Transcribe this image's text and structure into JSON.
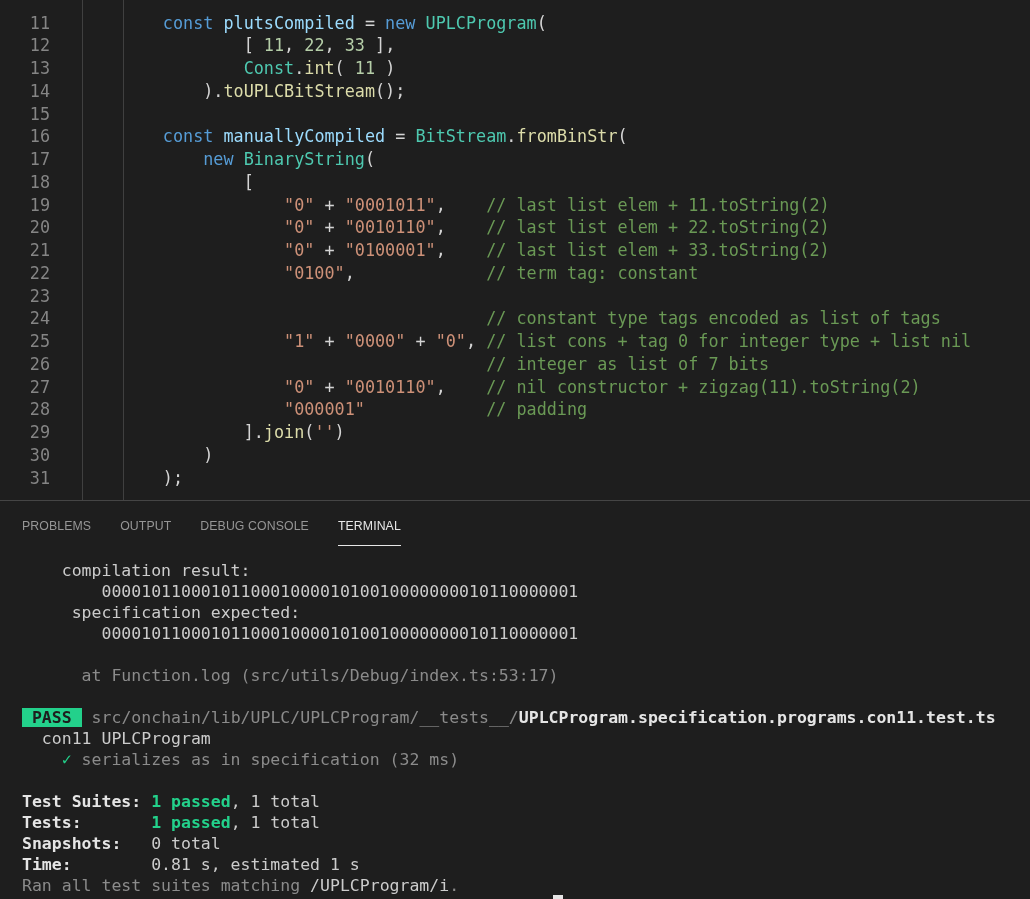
{
  "editor": {
    "lines": [
      {
        "number": "11",
        "tokens": [
          {
            "kind": "keyword",
            "text": "        const "
          },
          {
            "kind": "variable",
            "text": "plutsCompiled"
          },
          {
            "kind": "plain",
            "text": " = "
          },
          {
            "kind": "keyword",
            "text": "new "
          },
          {
            "kind": "class",
            "text": "UPLCProgram"
          },
          {
            "kind": "plain",
            "text": "("
          }
        ]
      },
      {
        "number": "12",
        "tokens": [
          {
            "kind": "plain",
            "text": "                [ "
          },
          {
            "kind": "number",
            "text": "11"
          },
          {
            "kind": "plain",
            "text": ", "
          },
          {
            "kind": "number",
            "text": "22"
          },
          {
            "kind": "plain",
            "text": ", "
          },
          {
            "kind": "number",
            "text": "33"
          },
          {
            "kind": "plain",
            "text": " ],"
          }
        ]
      },
      {
        "number": "13",
        "tokens": [
          {
            "kind": "class",
            "text": "                Const"
          },
          {
            "kind": "plain",
            "text": "."
          },
          {
            "kind": "function",
            "text": "int"
          },
          {
            "kind": "plain",
            "text": "( "
          },
          {
            "kind": "number",
            "text": "11"
          },
          {
            "kind": "plain",
            "text": " )"
          }
        ]
      },
      {
        "number": "14",
        "tokens": [
          {
            "kind": "plain",
            "text": "            )."
          },
          {
            "kind": "function",
            "text": "toUPLCBitStream"
          },
          {
            "kind": "plain",
            "text": "();"
          }
        ]
      },
      {
        "number": "15"
      },
      {
        "number": "16",
        "tokens": [
          {
            "kind": "keyword",
            "text": "        const "
          },
          {
            "kind": "variable",
            "text": "manuallyCompiled"
          },
          {
            "kind": "plain",
            "text": " = "
          },
          {
            "kind": "class",
            "text": "BitStream"
          },
          {
            "kind": "plain",
            "text": "."
          },
          {
            "kind": "function",
            "text": "fromBinStr"
          },
          {
            "kind": "plain",
            "text": "("
          }
        ]
      },
      {
        "number": "17",
        "tokens": [
          {
            "kind": "keyword",
            "text": "            new "
          },
          {
            "kind": "class",
            "text": "BinaryString"
          },
          {
            "kind": "plain",
            "text": "("
          }
        ]
      },
      {
        "number": "18",
        "tokens": [
          {
            "kind": "plain",
            "text": "                ["
          }
        ]
      },
      {
        "number": "19",
        "tokens": [
          {
            "kind": "string",
            "text": "                    \"0\""
          },
          {
            "kind": "plain",
            "text": " + "
          },
          {
            "kind": "string",
            "text": "\"0001011\""
          },
          {
            "kind": "plain",
            "text": ",    "
          },
          {
            "kind": "comment",
            "text": "// last list elem + 11.toString(2)"
          }
        ]
      },
      {
        "number": "20",
        "tokens": [
          {
            "kind": "string",
            "text": "                    \"0\""
          },
          {
            "kind": "plain",
            "text": " + "
          },
          {
            "kind": "string",
            "text": "\"0010110\""
          },
          {
            "kind": "plain",
            "text": ",    "
          },
          {
            "kind": "comment",
            "text": "// last list elem + 22.toString(2)"
          }
        ]
      },
      {
        "number": "21",
        "tokens": [
          {
            "kind": "string",
            "text": "                    \"0\""
          },
          {
            "kind": "plain",
            "text": " + "
          },
          {
            "kind": "string",
            "text": "\"0100001\""
          },
          {
            "kind": "plain",
            "text": ",    "
          },
          {
            "kind": "comment",
            "text": "// last list elem + 33.toString(2)"
          }
        ]
      },
      {
        "number": "22",
        "tokens": [
          {
            "kind": "string",
            "text": "                    \"0100\""
          },
          {
            "kind": "plain",
            "text": ",             "
          },
          {
            "kind": "comment",
            "text": "// term tag: constant"
          }
        ]
      },
      {
        "number": "23"
      },
      {
        "number": "24",
        "tokens": [
          {
            "kind": "comment",
            "text": "                                        // constant type tags encoded as list of tags"
          }
        ]
      },
      {
        "number": "25",
        "tokens": [
          {
            "kind": "string",
            "text": "                    \"1\""
          },
          {
            "kind": "plain",
            "text": " + "
          },
          {
            "kind": "string",
            "text": "\"0000\""
          },
          {
            "kind": "plain",
            "text": " + "
          },
          {
            "kind": "string",
            "text": "\"0\""
          },
          {
            "kind": "plain",
            "text": ", "
          },
          {
            "kind": "comment",
            "text": "// list cons + tag 0 for integer type + list nil"
          }
        ]
      },
      {
        "number": "26",
        "tokens": [
          {
            "kind": "comment",
            "text": "                                        // integer as list of 7 bits"
          }
        ]
      },
      {
        "number": "27",
        "tokens": [
          {
            "kind": "string",
            "text": "                    \"0\""
          },
          {
            "kind": "plain",
            "text": " + "
          },
          {
            "kind": "string",
            "text": "\"0010110\""
          },
          {
            "kind": "plain",
            "text": ",    "
          },
          {
            "kind": "comment",
            "text": "// nil constructor + zigzag(11).toString(2)"
          }
        ]
      },
      {
        "number": "28",
        "tokens": [
          {
            "kind": "string",
            "text": "                    \"000001\"            "
          },
          {
            "kind": "comment",
            "text": "// padding"
          }
        ]
      },
      {
        "number": "29",
        "tokens": [
          {
            "kind": "plain",
            "text": "                ]."
          },
          {
            "kind": "function",
            "text": "join"
          },
          {
            "kind": "plain",
            "text": "("
          },
          {
            "kind": "string",
            "text": "''"
          },
          {
            "kind": "plain",
            "text": ")"
          }
        ]
      },
      {
        "number": "30",
        "tokens": [
          {
            "kind": "plain",
            "text": "            )"
          }
        ]
      },
      {
        "number": "31",
        "tokens": [
          {
            "kind": "plain",
            "text": "        );"
          }
        ]
      }
    ]
  },
  "panel": {
    "tabs": [
      {
        "label": "PROBLEMS",
        "selected": false
      },
      {
        "label": "OUTPUT",
        "selected": false
      },
      {
        "label": "DEBUG CONSOLE",
        "selected": false
      },
      {
        "label": "TERMINAL",
        "selected": true
      }
    ]
  },
  "terminal": {
    "lines": [
      {
        "kind": "text",
        "spans": [
          {
            "kind": "plain",
            "text": "    compilation result:"
          }
        ]
      },
      {
        "kind": "text",
        "spans": [
          {
            "kind": "plain",
            "text": "        000010110001011000100001010010000000010110000001"
          }
        ]
      },
      {
        "kind": "text",
        "spans": [
          {
            "kind": "plain",
            "text": "     specification expected:"
          }
        ]
      },
      {
        "kind": "text",
        "spans": [
          {
            "kind": "plain",
            "text": "        000010110001011000100001010010000000010110000001"
          }
        ]
      },
      {
        "kind": "blank"
      },
      {
        "kind": "text",
        "spans": [
          {
            "kind": "dim",
            "text": "      at Function.log (src/utils/Debug/index.ts:53:17)"
          }
        ]
      },
      {
        "kind": "blank"
      },
      {
        "kind": "result",
        "badge": "PASS",
        "path": "src/onchain/lib/UPLC/UPLCProgram/__tests__/",
        "file": "UPLCProgram.specification.programs.con11.test.ts"
      },
      {
        "kind": "text",
        "spans": [
          {
            "kind": "plain",
            "text": "  con11 UPLCProgram"
          }
        ]
      },
      {
        "kind": "text",
        "spans": [
          {
            "kind": "green",
            "text": "    ✓"
          },
          {
            "kind": "dim",
            "text": " serializes as in specification (32 ms)"
          }
        ]
      },
      {
        "kind": "blank"
      },
      {
        "kind": "text",
        "spans": [
          {
            "kind": "bold",
            "text": "Test Suites: "
          },
          {
            "kind": "greenbold",
            "text": "1 passed"
          },
          {
            "kind": "plain",
            "text": ", 1 total"
          }
        ]
      },
      {
        "kind": "text",
        "spans": [
          {
            "kind": "bold",
            "text": "Tests:       "
          },
          {
            "kind": "greenbold",
            "text": "1 passed"
          },
          {
            "kind": "plain",
            "text": ", 1 total"
          }
        ]
      },
      {
        "kind": "text",
        "spans": [
          {
            "kind": "bold",
            "text": "Snapshots:   "
          },
          {
            "kind": "plain",
            "text": "0 total"
          }
        ]
      },
      {
        "kind": "text",
        "spans": [
          {
            "kind": "bold",
            "text": "Time:        "
          },
          {
            "kind": "plain",
            "text": "0.81 s, estimated 1 s"
          }
        ]
      },
      {
        "kind": "text",
        "spans": [
          {
            "kind": "dim",
            "text": "Ran all test suites matching "
          },
          {
            "kind": "plain",
            "text": "/UPLCProgram/i"
          },
          {
            "kind": "dim",
            "text": "."
          }
        ]
      },
      {
        "kind": "cursor"
      }
    ]
  }
}
